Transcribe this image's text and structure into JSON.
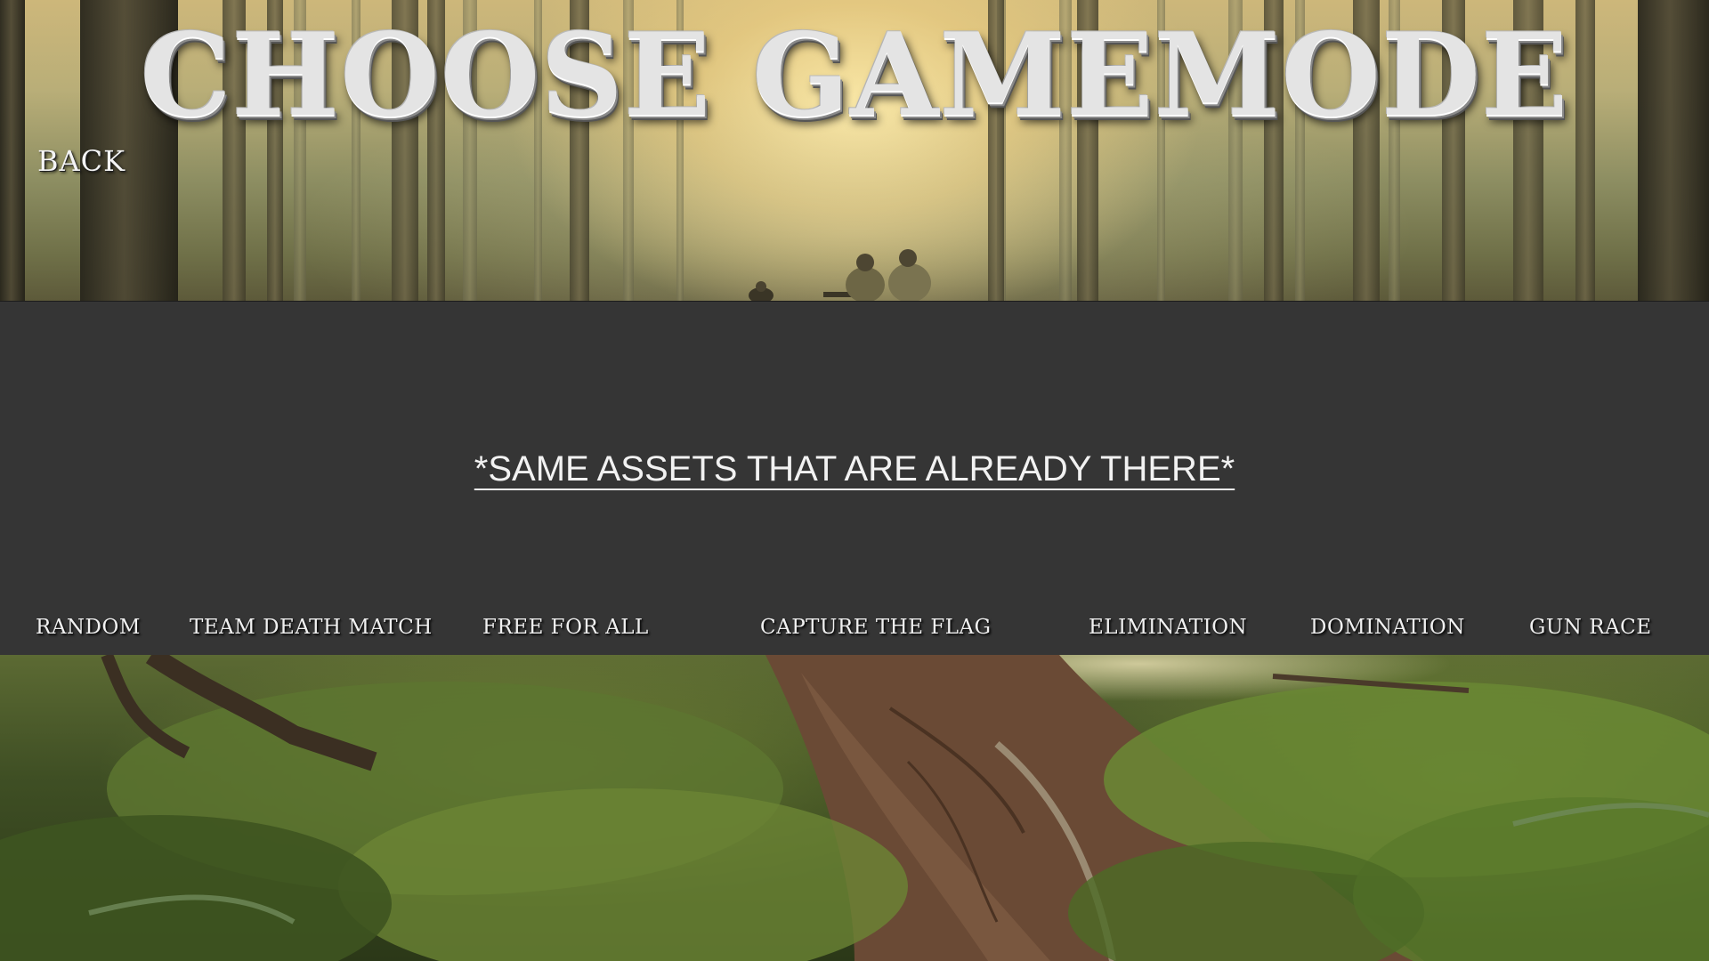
{
  "title": "CHOOSE GAMEMODE",
  "back_label": "BACK",
  "placeholder_note": "*SAME ASSETS THAT ARE ALREADY THERE*",
  "modes": [
    {
      "label": "RANDOM"
    },
    {
      "label": "TEAM DEATH MATCH"
    },
    {
      "label": "FREE FOR ALL"
    },
    {
      "label": "CAPTURE THE FLAG"
    },
    {
      "label": "ELIMINATION"
    },
    {
      "label": "DOMINATION"
    },
    {
      "label": "GUN RACE"
    }
  ],
  "colors": {
    "band": "#353535",
    "text": "#f0f0f0"
  }
}
